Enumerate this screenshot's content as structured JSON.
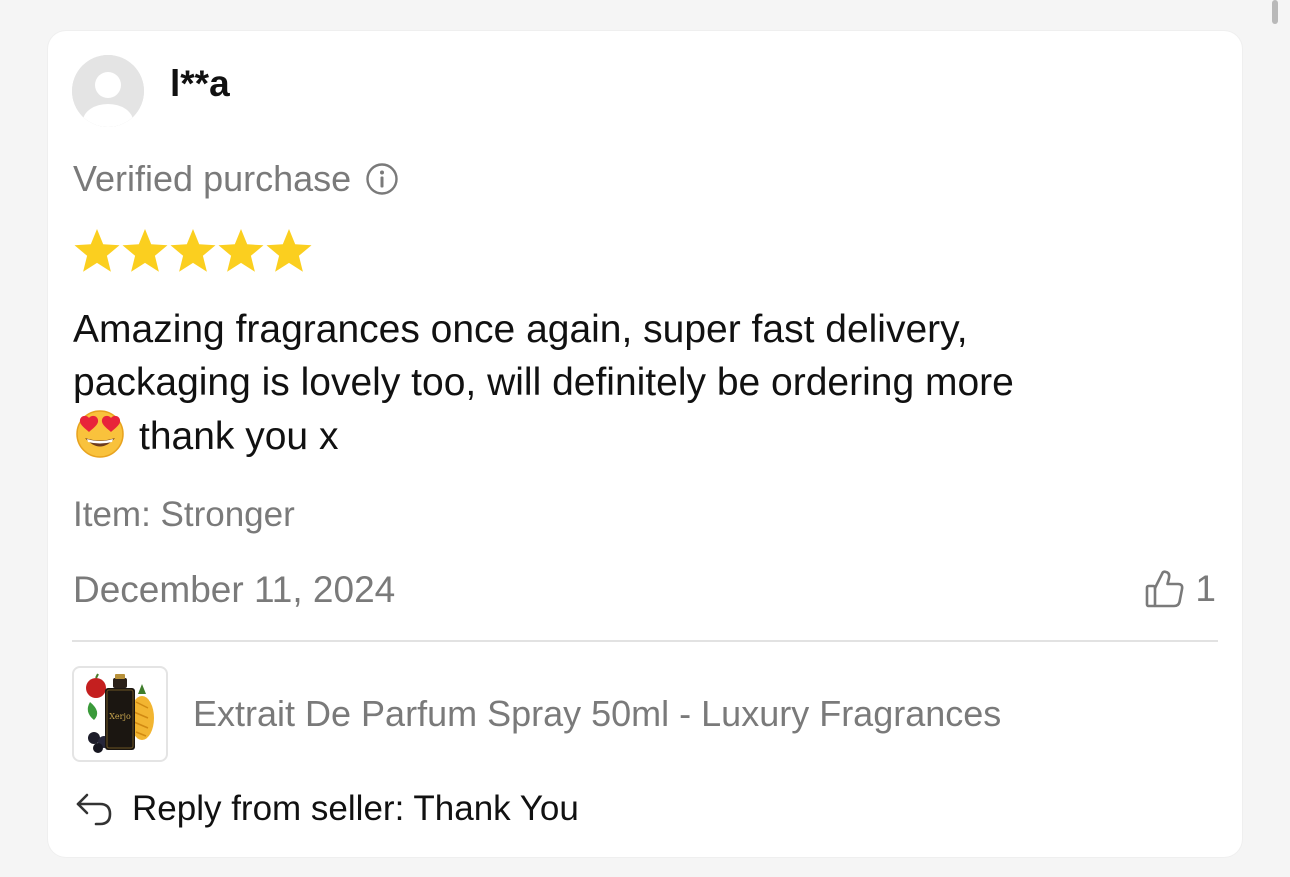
{
  "review": {
    "username": "l**a",
    "verified_label": "Verified purchase",
    "rating": 5,
    "star_color": "#fbcf1f",
    "text_line1": "Amazing fragrances once again, super fast delivery,",
    "text_line2": "packaging is lovely too, will definitely be ordering more",
    "text_line3": "thank you x",
    "emoji_name": "heart-eyes-emoji",
    "item_label": "Item: Stronger",
    "date": "December 11, 2024",
    "helpful_count": "1"
  },
  "product": {
    "name": "Extrait De Parfum Spray 50ml - Luxury Fragrances",
    "thumb_label": "Xerjoff"
  },
  "reply": {
    "text": "Reply from seller: Thank You"
  },
  "icons": {
    "info": "info-circle-icon",
    "star": "star-icon",
    "thumbs_up": "thumbs-up-icon",
    "reply": "reply-arrow-icon",
    "avatar": "default-avatar-icon"
  },
  "colors": {
    "text_primary": "#111111",
    "text_secondary": "#7a7a7a",
    "star": "#fbcf1f",
    "background": "#f5f5f5",
    "card": "#ffffff"
  }
}
